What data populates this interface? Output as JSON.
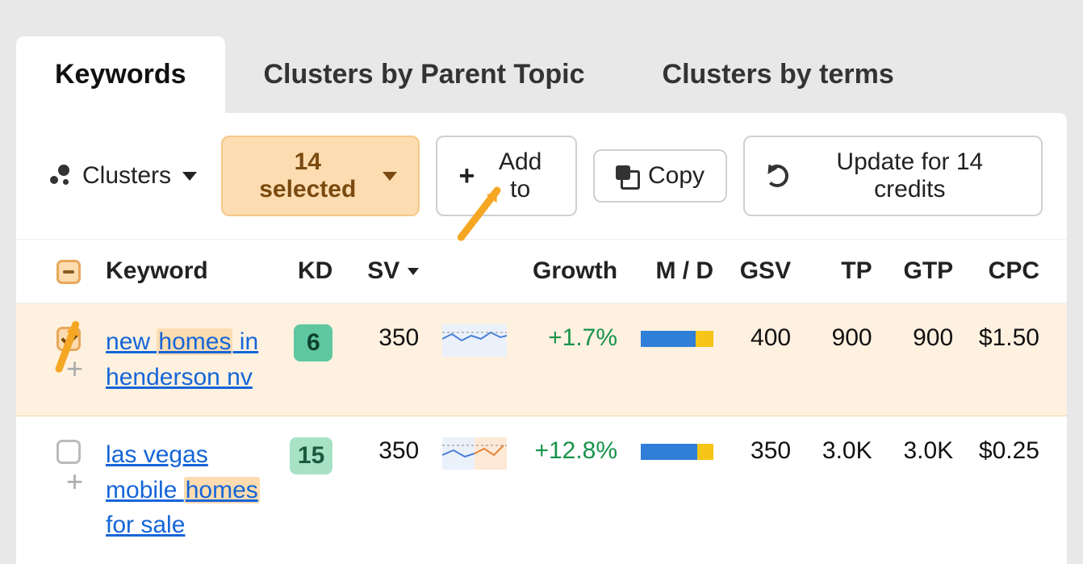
{
  "tabs": [
    {
      "label": "Keywords",
      "active": true
    },
    {
      "label": "Clusters by Parent Topic",
      "active": false
    },
    {
      "label": "Clusters by terms",
      "active": false
    }
  ],
  "toolbar": {
    "clusters_label": "Clusters",
    "selected_label": "14 selected",
    "addto_label": "Add to",
    "copy_label": "Copy",
    "update_label": "Update for 14 credits"
  },
  "columns": {
    "keyword": "Keyword",
    "kd": "KD",
    "sv": "SV",
    "growth": "Growth",
    "md": "M / D",
    "gsv": "GSV",
    "tp": "TP",
    "gtp": "GTP",
    "cpc": "CPC"
  },
  "rows": [
    {
      "selected": true,
      "keyword_parts": [
        "new ",
        "homes",
        " in henderson nv"
      ],
      "highlight_index": 1,
      "kd": "6",
      "kd_class": "kd-green-dark",
      "sv": "350",
      "growth": "+1.7%",
      "md_class": "r1",
      "gsv": "400",
      "tp": "900",
      "gtp": "900",
      "cpc": "$1.50"
    },
    {
      "selected": false,
      "keyword_parts": [
        "las vegas mobile ",
        "homes",
        " for sale"
      ],
      "highlight_index": 1,
      "kd": "15",
      "kd_class": "kd-green-light",
      "sv": "350",
      "growth": "+12.8%",
      "md_class": "r2",
      "gsv": "350",
      "tp": "3.0K",
      "gtp": "3.0K",
      "cpc": "$0.25"
    }
  ]
}
